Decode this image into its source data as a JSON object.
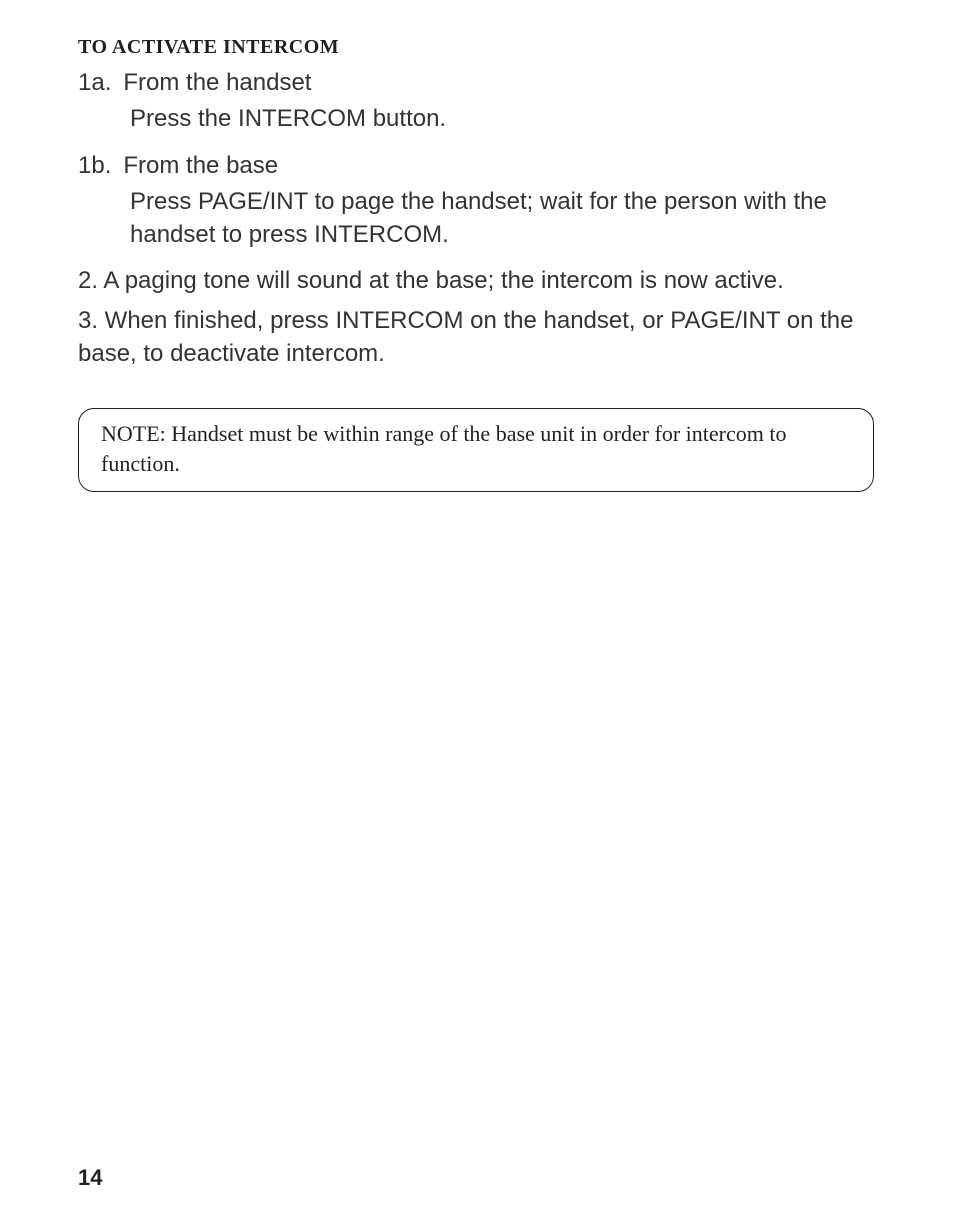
{
  "heading": "TO ACTIVATE INTERCOM",
  "steps": {
    "s1a_marker": "1a.",
    "s1a_text": "From the handset",
    "s1a_sub": "Press the INTERCOM button.",
    "s1b_marker": "1b.",
    "s1b_text": "From the base",
    "s1b_sub": "Press PAGE/INT to page the handset; wait for the person with the handset to press INTERCOM.",
    "s2": "2. A paging tone will sound at the base; the intercom is now active.",
    "s3": "3. When finished, press INTERCOM on the handset, or PAGE/INT on the base, to deactivate intercom."
  },
  "note": "NOTE: Handset must be within range of the base unit in order for intercom to function.",
  "page_number": "14"
}
